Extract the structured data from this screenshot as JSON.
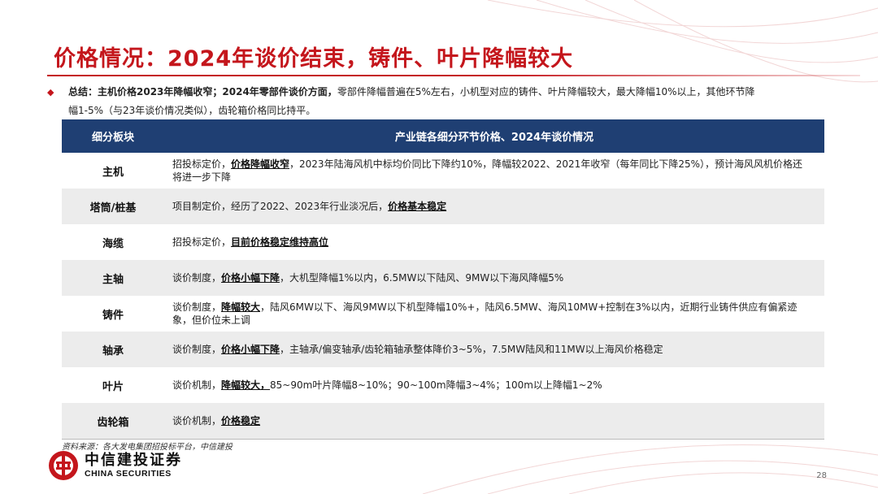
{
  "title": "价格情况：2024年谈价结束，铸件、叶片降幅较大",
  "summary": {
    "bullet": "◆",
    "bold": "总结：主机价格2023年降幅收窄；2024年零部件谈价方面，",
    "text": "零部件降幅普遍在5%左右，小机型对应的铸件、叶片降幅较大，最大降幅10%以上，其他环节降",
    "line2": "幅1-5%（与23年谈价情况类似），齿轮箱价格同比持平。"
  },
  "table": {
    "headers": [
      "细分板块",
      "产业链各细分环节价格、2024年谈价情况"
    ],
    "rows": [
      {
        "segment": "主机",
        "pre": "招投标定价，",
        "em": "价格降幅收窄",
        "post": "，2023年陆海风机中标均价同比下降约10%，降幅较2022、2021年收窄（每年同比下降25%），预计海风风机价格还将进一步下降"
      },
      {
        "segment": "塔筒/桩基",
        "pre": "项目制定价，经历了2022、2023年行业淡况后，",
        "em": "价格基本稳定",
        "post": ""
      },
      {
        "segment": "海缆",
        "pre": "招投标定价，",
        "em": "目前价格稳定维持高位",
        "post": ""
      },
      {
        "segment": "主轴",
        "pre": "谈价制度，",
        "em": "价格小幅下降",
        "post": "，大机型降幅1%以内，6.5MW以下陆风、9MW以下海风降幅5%"
      },
      {
        "segment": "铸件",
        "pre": "谈价制度，",
        "em": "降幅较大",
        "post": "，陆风6MW以下、海风9MW以下机型降幅10%+，陆风6.5MW、海风10MW+控制在3%以内，近期行业铸件供应有偏紧迹象，但价位未上调"
      },
      {
        "segment": "轴承",
        "pre": "谈价制度，",
        "em": "价格小幅下降",
        "post": "，主轴承/偏变轴承/齿轮箱轴承整体降价3~5%，7.5MW陆风和11MW以上海风价格稳定"
      },
      {
        "segment": "叶片",
        "pre": "谈价机制，",
        "em": "降幅较大，",
        "post": "85~90m叶片降幅8~10%；90~100m降幅3~4%；100m以上降幅1~2%"
      },
      {
        "segment": "齿轮箱",
        "pre": "谈价机制，",
        "em": "价格稳定",
        "post": ""
      }
    ]
  },
  "source": "资料来源：各大发电集团招投标平台，中信建投",
  "logo": {
    "cn": "中信建投证券",
    "en": "CHINA SECURITIES",
    "icon": "citic-logo-icon"
  },
  "page_number": "28",
  "colors": {
    "accent": "#c4161c",
    "header_bg": "#1f3f73",
    "alt_row": "#ececec"
  }
}
